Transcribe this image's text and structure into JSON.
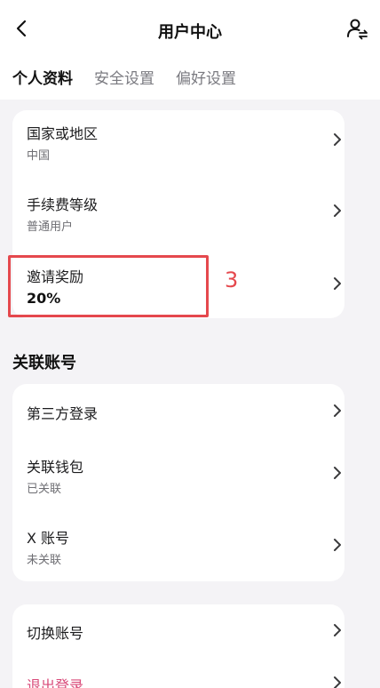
{
  "header": {
    "title": "用户中心",
    "tabs": [
      {
        "label": "个人资料",
        "active": true
      },
      {
        "label": "安全设置",
        "active": false
      },
      {
        "label": "偏好设置",
        "active": false
      }
    ]
  },
  "profile_card": {
    "items": [
      {
        "title": "国家或地区",
        "subtitle": "中国"
      },
      {
        "title": "手续费等级",
        "subtitle": "普通用户"
      },
      {
        "title": "邀请奖励",
        "subtitle": "20%"
      }
    ]
  },
  "annotation": {
    "marker": "3",
    "color": "#e5484d"
  },
  "linked_section": {
    "title": "关联账号",
    "items": [
      {
        "title": "第三方登录"
      },
      {
        "title": "关联钱包",
        "subtitle": "已关联"
      },
      {
        "title": "X 账号",
        "subtitle": "未关联"
      }
    ]
  },
  "account_card": {
    "items": [
      {
        "title": "切换账号"
      },
      {
        "title": "退出登录"
      }
    ]
  },
  "icons": {
    "back": "chevron-left-icon",
    "user_switch": "user-switch-icon",
    "row_arrow": "chevron-right-icon"
  },
  "colors": {
    "background": "#f4f3f6",
    "card": "#ffffff",
    "highlight": "#e5484d",
    "logout_text": "#d94b7a"
  }
}
